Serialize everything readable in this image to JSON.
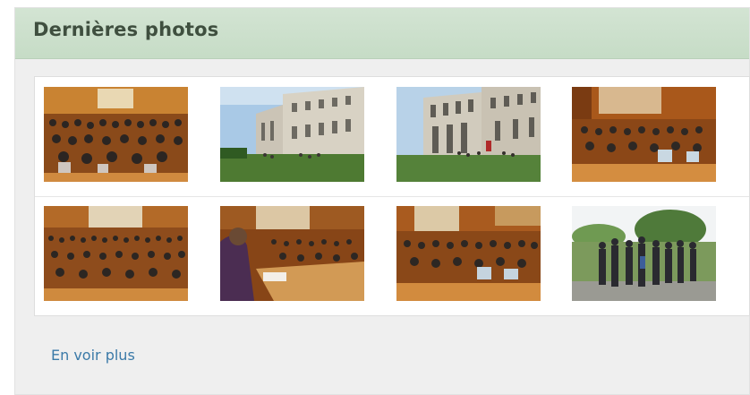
{
  "widget": {
    "title": "Dernières photos",
    "more_label": "En voir plus"
  },
  "photos": [
    {
      "id": "photo-1",
      "scene": "lecture-hall-audience"
    },
    {
      "id": "photo-2",
      "scene": "building-courtyard"
    },
    {
      "id": "photo-3",
      "scene": "building-courtyard"
    },
    {
      "id": "photo-4",
      "scene": "lecture-hall-audience"
    },
    {
      "id": "photo-5",
      "scene": "lecture-hall-audience"
    },
    {
      "id": "photo-6",
      "scene": "lecture-speaker"
    },
    {
      "id": "photo-7",
      "scene": "lecture-hall-audience"
    },
    {
      "id": "photo-8",
      "scene": "outdoor-group"
    }
  ],
  "colors": {
    "header_bg": "#cfe2cf",
    "title": "#3f4f3f",
    "link": "#3b7aa8",
    "panel_bg": "#efefef"
  }
}
